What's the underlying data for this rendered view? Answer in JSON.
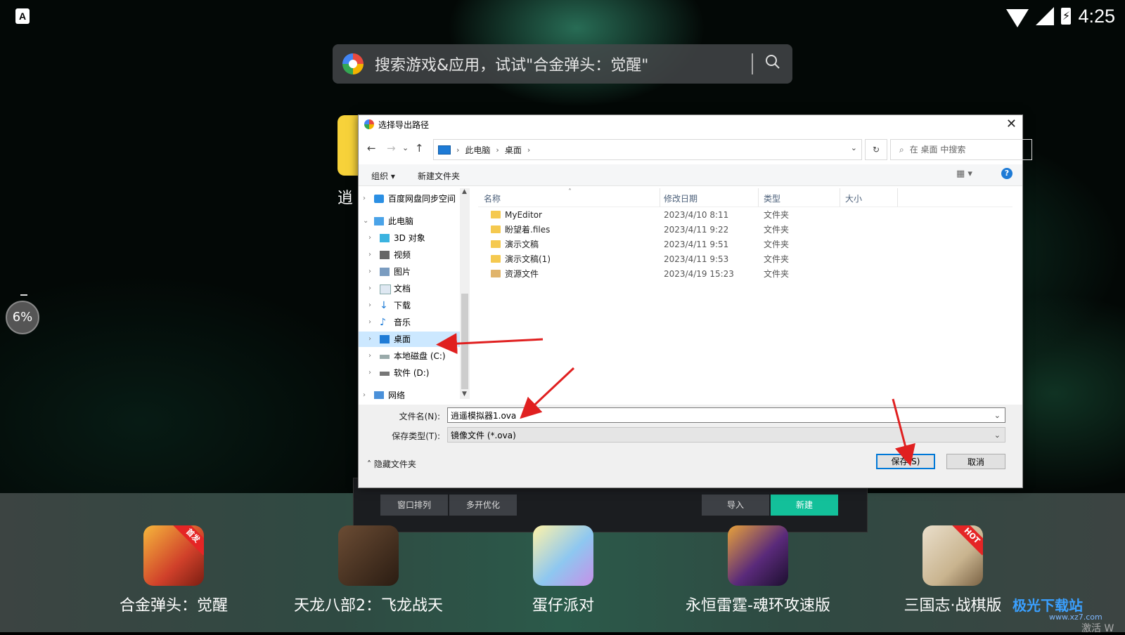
{
  "status": {
    "notification_icon": "A",
    "time": "4:25",
    "battery_glyph": "⚡"
  },
  "search": {
    "placeholder": "搜索游戏&应用，试试\"合金弹头：觉醒\"",
    "icon": "search-icon"
  },
  "side": {
    "partial_char": "逍"
  },
  "progress": {
    "label": "6%",
    "value": 6
  },
  "dialog": {
    "title": "选择导出路径",
    "close": "✕",
    "nav": {
      "back": "←",
      "forward": "→",
      "recent": "⌄",
      "up": "↑"
    },
    "breadcrumb": [
      "此电脑",
      "桌面"
    ],
    "refresh": "↻",
    "search_placeholder": "在 桌面 中搜索",
    "toolbar": {
      "organize": "组织 ▾",
      "new_folder": "新建文件夹",
      "view": "▦ ▾",
      "help": "?"
    },
    "tree": [
      {
        "label": "百度网盘同步空间",
        "icon": "cloud-icon"
      },
      {
        "label": "此电脑",
        "icon": "pc-icon"
      },
      {
        "label": "3D 对象",
        "icon": "cube-icon"
      },
      {
        "label": "视频",
        "icon": "video-icon"
      },
      {
        "label": "图片",
        "icon": "picture-icon"
      },
      {
        "label": "文档",
        "icon": "document-icon"
      },
      {
        "label": "下载",
        "icon": "download-icon"
      },
      {
        "label": "音乐",
        "icon": "music-icon"
      },
      {
        "label": "桌面",
        "icon": "desktop-icon",
        "selected": true
      },
      {
        "label": "本地磁盘 (C:)",
        "icon": "drive-icon"
      },
      {
        "label": "软件 (D:)",
        "icon": "drive-icon"
      },
      {
        "label": "网络",
        "icon": "network-icon"
      }
    ],
    "columns": {
      "name": "名称",
      "modified": "修改日期",
      "type": "类型",
      "size": "大小"
    },
    "files": [
      {
        "name": "MyEditor",
        "modified": "2023/4/10 8:11",
        "type": "文件夹"
      },
      {
        "name": "盼望着.files",
        "modified": "2023/4/11 9:22",
        "type": "文件夹"
      },
      {
        "name": "演示文稿",
        "modified": "2023/4/11 9:51",
        "type": "文件夹"
      },
      {
        "name": "演示文稿(1)",
        "modified": "2023/4/11 9:53",
        "type": "文件夹"
      },
      {
        "name": "资源文件",
        "modified": "2023/4/19 15:23",
        "type": "文件夹"
      }
    ],
    "filename_label": "文件名(N):",
    "filename_value": "逍遥模拟器1.ova",
    "filetype_label": "保存类型(T):",
    "filetype_value": "镜像文件 (*.ova)",
    "hide_folders": "隐藏文件夹",
    "save": "保存(S)",
    "cancel": "取消"
  },
  "emulator": {
    "arrange": "窗口排列",
    "multi_opt": "多开优化",
    "import": "导入",
    "new": "新建"
  },
  "apps": [
    {
      "label": "合金弹头：觉醒",
      "badge": "首发",
      "color": "#d0402a"
    },
    {
      "label": "天龙八部2：飞龙战天",
      "badge": "",
      "color": "#4a3526"
    },
    {
      "label": "蛋仔派对",
      "badge": "",
      "color": "#8ec7f0"
    },
    {
      "label": "永恒雷霆-魂环攻速版",
      "badge": "",
      "color": "#5a2a7a"
    },
    {
      "label": "三国志·战棋版",
      "badge": "HOT",
      "color": "#c9b48f"
    }
  ],
  "watermark": {
    "title": "极光下载站",
    "url": "www.xz7.com",
    "activate": "激活 W"
  },
  "colors": {
    "accent_blue": "#0078d7",
    "selection": "#cce8ff",
    "teal_button": "#13c09a",
    "arrow_red": "#e02020"
  }
}
